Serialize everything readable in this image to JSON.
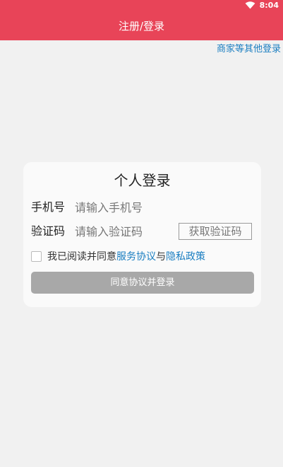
{
  "status_bar": {
    "time": "8:04",
    "wifi_icon": "wifi-icon"
  },
  "header": {
    "title": "注册/登录"
  },
  "merchant_link": "商家等其他登录",
  "login_card": {
    "title": "个人登录",
    "phone": {
      "label": "手机号",
      "placeholder": "请输入手机号",
      "value": ""
    },
    "code": {
      "label": "验证码",
      "placeholder": "请输入验证码",
      "value": "",
      "button": "获取验证码"
    },
    "agreement": {
      "prefix": "我已阅读并同意",
      "service_link": "服务协议",
      "conjunction": "与",
      "privacy_link": "隐私政策",
      "checked": false
    },
    "submit_label": "同意协议并登录"
  },
  "colors": {
    "header_bg": "#e84458",
    "link": "#1a7ec1",
    "button_disabled": "#a8a8a8",
    "page_bg": "#f1f1f1"
  }
}
